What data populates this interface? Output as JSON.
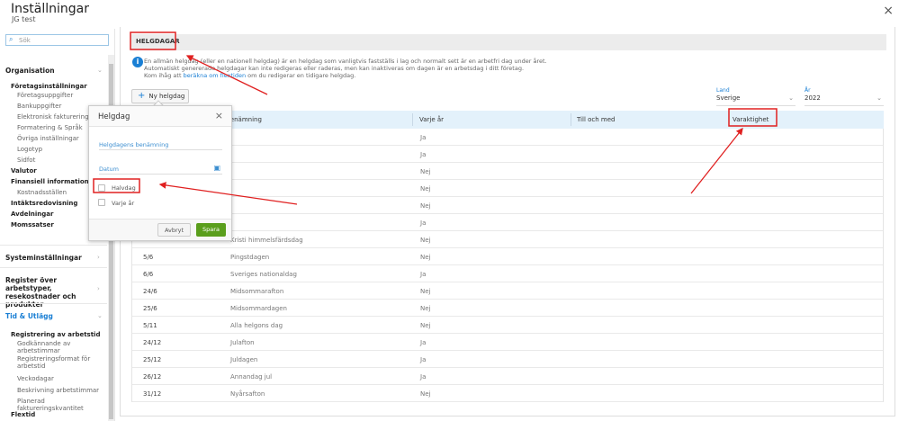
{
  "header": {
    "title": "Inställningar",
    "subtitle": "JG test",
    "close": "×"
  },
  "sidebar": {
    "search_placeholder": "Sök",
    "items": [
      {
        "label": "Organisation",
        "level": "section",
        "chevron": "⌄"
      },
      {
        "label": "Företagsinställningar",
        "level": "group"
      },
      {
        "label": "Företagsuppgifter",
        "level": "item"
      },
      {
        "label": "Bankuppgifter",
        "level": "item"
      },
      {
        "label": "Elektronisk fakturering",
        "level": "item"
      },
      {
        "label": "Formatering & Språk",
        "level": "item"
      },
      {
        "label": "Övriga inställningar",
        "level": "item"
      },
      {
        "label": "Logotyp",
        "level": "item"
      },
      {
        "label": "Sidfot",
        "level": "item"
      },
      {
        "label": "Valutor",
        "level": "group"
      },
      {
        "label": "Finansiell information",
        "level": "group"
      },
      {
        "label": "Kostnadsställen",
        "level": "item"
      },
      {
        "label": "Intäktsredovisning",
        "level": "group"
      },
      {
        "label": "Avdelningar",
        "level": "group"
      },
      {
        "label": "Momssatser",
        "level": "group"
      },
      {
        "label": "Systeminställningar",
        "level": "section",
        "chevron": "›"
      },
      {
        "label": "Register över arbetstyper, resekostnader och produkter",
        "level": "section",
        "chevron": "›"
      },
      {
        "label": "Tid & Utlägg",
        "level": "section",
        "chevron": "⌄"
      },
      {
        "label": "Registrering av arbetstid",
        "level": "group"
      },
      {
        "label": "Godkännande av arbetstimmar",
        "level": "item"
      },
      {
        "label": "Registreringsformat för arbetstid",
        "level": "item"
      },
      {
        "label": "Veckodagar",
        "level": "item"
      },
      {
        "label": "Beskrivning arbetstimmar",
        "level": "item"
      },
      {
        "label": "Planerad faktureringskvantitet",
        "level": "item"
      },
      {
        "label": "Flextid",
        "level": "group"
      }
    ]
  },
  "main": {
    "tab": "HELGDAGAR",
    "info": {
      "line1": "En allmän helgdag (eller en nationell helgdag) är en helgdag som vanligtvis fastställs i lag och normalt sett är en arbetfri dag under året.",
      "line2": "Automatiskt genererade helgdagar kan inte redigeras eller raderas, men kan inaktiveras om dagen är en arbetsdag i ditt företag.",
      "line3_pre": "Kom ihåg att ",
      "line3_link": "beräkna om flextiden",
      "line3_post": " om du redigerar en tidigare helgdag."
    },
    "new_button": "Ny helgdag",
    "country": {
      "label": "Land",
      "value": "Sverige"
    },
    "year": {
      "label": "År",
      "value": "2022"
    },
    "columns": [
      "Benämning",
      "Varje år",
      "Till och med",
      "Varaktighet"
    ],
    "rows": [
      {
        "date": "",
        "name": "",
        "every_year": "Ja"
      },
      {
        "date": "",
        "name": "",
        "every_year": "Ja"
      },
      {
        "date": "",
        "name": "",
        "every_year": "Nej"
      },
      {
        "date": "",
        "name": "",
        "every_year": "Nej"
      },
      {
        "date": "",
        "name": "",
        "every_year": "Nej"
      },
      {
        "date": "",
        "name": "",
        "every_year": "Ja"
      },
      {
        "date": "",
        "name": "Kristi himmelsfärdsdag",
        "every_year": "Nej"
      },
      {
        "date": "5/6",
        "name": "Pingstdagen",
        "every_year": "Nej"
      },
      {
        "date": "6/6",
        "name": "Sveriges nationaldag",
        "every_year": "Ja"
      },
      {
        "date": "24/6",
        "name": "Midsommarafton",
        "every_year": "Nej"
      },
      {
        "date": "25/6",
        "name": "Midsommardagen",
        "every_year": "Nej"
      },
      {
        "date": "5/11",
        "name": "Alla helgons dag",
        "every_year": "Nej"
      },
      {
        "date": "24/12",
        "name": "Julafton",
        "every_year": "Ja"
      },
      {
        "date": "25/12",
        "name": "Juldagen",
        "every_year": "Ja"
      },
      {
        "date": "26/12",
        "name": "Annandag jul",
        "every_year": "Ja"
      },
      {
        "date": "31/12",
        "name": "Nyårsafton",
        "every_year": "Nej"
      }
    ]
  },
  "popup": {
    "title": "Helgdag",
    "name_label": "Helgdagens benämning",
    "date_label": "Datum",
    "half_day": "Halvdag",
    "every_year": "Varje år",
    "cancel": "Avbryt",
    "save": "Spara"
  },
  "colors": {
    "accent": "#1a7fd4",
    "save": "#5a9e1c",
    "annotation": "#e02020",
    "header_bg": "#e3f1fb"
  }
}
